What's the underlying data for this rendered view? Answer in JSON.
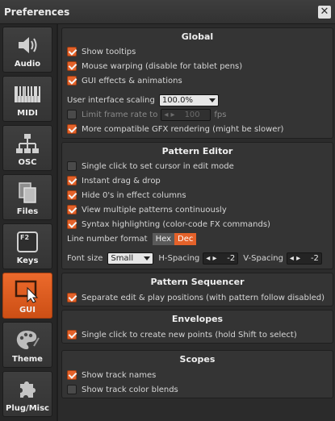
{
  "window": {
    "title": "Preferences",
    "close_glyph": "✕"
  },
  "sidebar": {
    "items": [
      {
        "label": "Audio",
        "icon": "speaker-icon"
      },
      {
        "label": "MIDI",
        "icon": "piano-keys-icon"
      },
      {
        "label": "OSC",
        "icon": "network-icon"
      },
      {
        "label": "Files",
        "icon": "files-icon"
      },
      {
        "label": "Keys",
        "icon": "keyboard-key-icon",
        "key_text": "F2"
      },
      {
        "label": "GUI",
        "icon": "gui-cursor-icon",
        "active": true
      },
      {
        "label": "Theme",
        "icon": "palette-icon"
      },
      {
        "label": "Plug/Misc",
        "icon": "puzzle-icon"
      }
    ],
    "accent_color": "#e4622a"
  },
  "global": {
    "title": "Global",
    "show_tooltips": "Show tooltips",
    "mouse_warping": "Mouse warping (disable for tablet pens)",
    "gui_effects": "GUI effects & animations",
    "ui_scaling_label": "User interface scaling",
    "ui_scaling_value": "100.0%",
    "limit_frame_rate": "Limit frame rate to",
    "fps_value": "100",
    "fps_unit": "fps",
    "gfx_rendering": "More compatible GFX rendering (might be slower)"
  },
  "pattern_editor": {
    "title": "Pattern Editor",
    "single_click_cursor": "Single click to set cursor in edit mode",
    "instant_drag": "Instant drag & drop",
    "hide_zeros": "Hide 0's in effect columns",
    "view_multiple": "View multiple patterns continuously",
    "syntax_highlighting": "Syntax highlighting (color-code FX commands)",
    "line_number_format_label": "Line number format",
    "hex_label": "Hex",
    "dec_label": "Dec",
    "font_size_label": "Font size",
    "font_size_value": "Small",
    "h_spacing_label": "H-Spacing",
    "h_spacing_value": "-2",
    "v_spacing_label": "V-Spacing",
    "v_spacing_value": "-2"
  },
  "pattern_sequencer": {
    "title": "Pattern Sequencer",
    "separate_positions": "Separate edit & play positions (with pattern follow disabled)"
  },
  "envelopes": {
    "title": "Envelopes",
    "single_click_points": "Single click to create new points (hold Shift to select)"
  },
  "scopes": {
    "title": "Scopes",
    "show_track_names": "Show track names",
    "show_track_color_blends": "Show track color blends"
  }
}
